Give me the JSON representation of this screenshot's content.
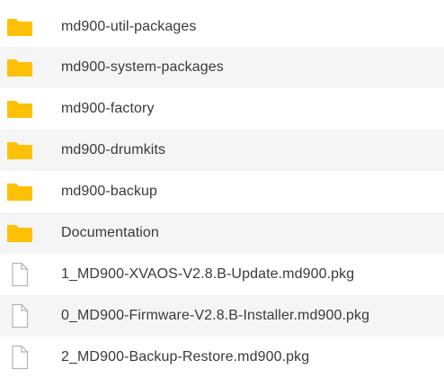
{
  "folder_color": "#FFC107",
  "file_icon_stroke": "#b5b5b5",
  "items": [
    {
      "type": "folder",
      "icon": "folder-icon",
      "name": "md900-util-packages"
    },
    {
      "type": "folder",
      "icon": "folder-icon",
      "name": "md900-system-packages"
    },
    {
      "type": "folder",
      "icon": "folder-icon",
      "name": "md900-factory"
    },
    {
      "type": "folder",
      "icon": "folder-icon",
      "name": "md900-drumkits"
    },
    {
      "type": "folder",
      "icon": "folder-icon",
      "name": "md900-backup"
    },
    {
      "type": "folder",
      "icon": "folder-icon",
      "name": "Documentation"
    },
    {
      "type": "file",
      "icon": "file-icon",
      "name": "1_MD900-XVAOS-V2.8.B-Update.md900.pkg"
    },
    {
      "type": "file",
      "icon": "file-icon",
      "name": "0_MD900-Firmware-V2.8.B-Installer.md900.pkg"
    },
    {
      "type": "file",
      "icon": "file-icon",
      "name": "2_MD900-Backup-Restore.md900.pkg"
    }
  ]
}
